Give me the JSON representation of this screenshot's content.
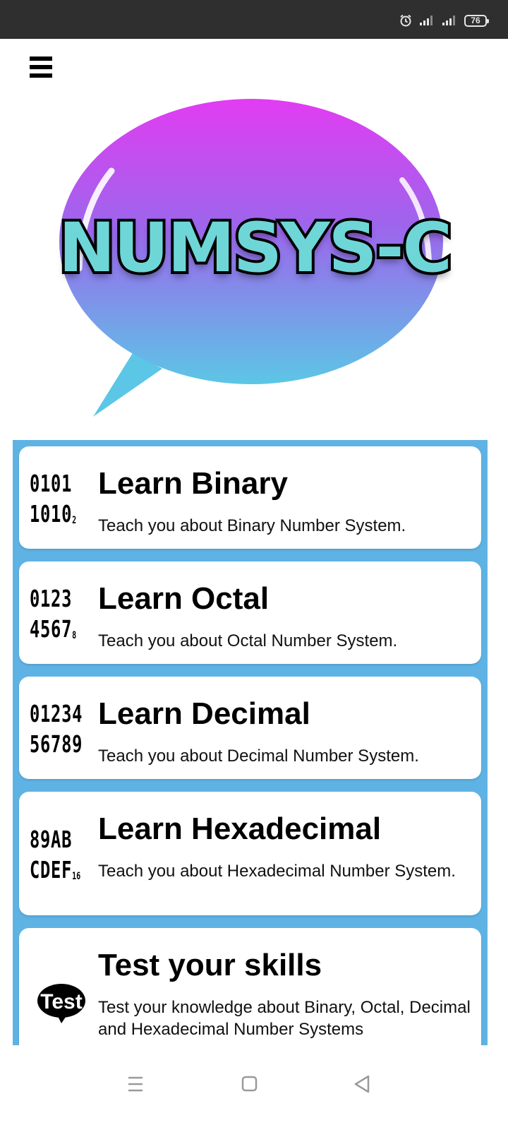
{
  "status_bar": {
    "battery": "76",
    "icons": [
      "alarm-icon",
      "signal-icon",
      "signal-icon",
      "battery-icon"
    ]
  },
  "header": {
    "menu_icon": "hamburger-menu-icon",
    "logo_text": "NUMSYS-C"
  },
  "cards": [
    {
      "icon_lines": [
        "0101",
        "1010"
      ],
      "icon_subscript": "2",
      "title": "Learn Binary",
      "description": "Teach you about Binary Number System."
    },
    {
      "icon_lines": [
        "0123",
        "4567"
      ],
      "icon_subscript": "8",
      "title": "Learn Octal",
      "description": "Teach you about Octal Number System."
    },
    {
      "icon_lines": [
        "01234",
        "56789"
      ],
      "icon_subscript": "",
      "title": "Learn Decimal",
      "description": "Teach you about Decimal Number System."
    },
    {
      "icon_lines": [
        "89AB",
        "CDEF"
      ],
      "icon_subscript": "16",
      "title": "Learn Hexadecimal",
      "description": "Teach you about Hexadecimal Number System."
    },
    {
      "icon_text": "Test",
      "title": "Test your skills",
      "description": "Test your knowledge about Binary, Octal, Decimal and Hexadecimal Number Systems"
    }
  ],
  "nav": {
    "icons": [
      "recent-apps-icon",
      "home-icon",
      "back-icon"
    ]
  },
  "colors": {
    "status_bar": "#2f2f2f",
    "list_background": "#5fb3e4",
    "logo_fill": "#6fd6d8",
    "bubble_top": "#e23cf2",
    "bubble_bottom": "#5cc6e6"
  }
}
